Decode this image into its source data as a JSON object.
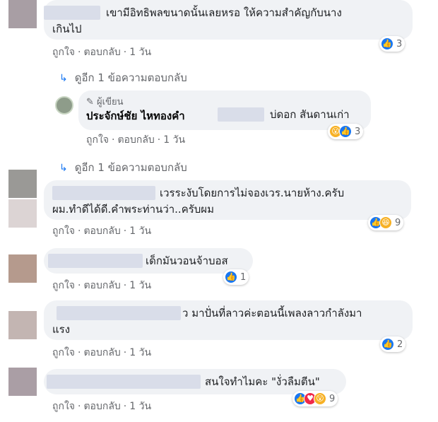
{
  "comments": [
    {
      "text_lines": [
        "เขามีอิทธิพลขนาดนั้นเลยหรอ ให้ความสำคัญกับนาง",
        "เกินไป"
      ],
      "meta": {
        "like": "ถูกใจ",
        "reply": "ตอบกลับ",
        "time": "1 วัน"
      },
      "reactions": {
        "icons": [
          "like-icon"
        ],
        "count": "3"
      },
      "replies_link": "ดูอีก 1 ข้อความตอบกลับ"
    },
    {
      "author_badge": "ผู้เขียน",
      "author_name": "ประจักษ์ชัย ไหทองคำ",
      "text_lines": [
        "บ่ดอก สันดานเก่า"
      ],
      "meta": {
        "like": "ถูกใจ",
        "reply": "ตอบกลับ",
        "time": "1 วัน"
      },
      "reactions": {
        "icons": [
          "wow-icon",
          "like-icon"
        ],
        "count": "3"
      },
      "replies_link": "ดูอีก 1 ข้อความตอบกลับ"
    },
    {
      "text_lines": [
        "เวรระงับโดยการไม่จองเวร.นายห้าง.ครับ",
        "ผม.ทำดีได้ดี.คำพระท่านว่า..ครับผม"
      ],
      "meta": {
        "like": "ถูกใจ",
        "reply": "ตอบกลับ",
        "time": "1 วัน"
      },
      "reactions": {
        "icons": [
          "like-icon",
          "haha-icon"
        ],
        "count": "9"
      }
    },
    {
      "text_lines": [
        "เด็กมันวอนจ้าบอส"
      ],
      "meta": {
        "like": "ถูกใจ",
        "reply": "ตอบกลับ",
        "time": "1 วัน"
      },
      "reactions": {
        "icons": [
          "like-icon"
        ],
        "count": "1"
      }
    },
    {
      "text_lines": [
        "ว มาปั่นที่ลาวค่ะตอนนี้เพลงลาวกำลังมา",
        "แรง"
      ],
      "meta": {
        "like": "ถูกใจ",
        "reply": "ตอบกลับ",
        "time": "1 วัน"
      },
      "reactions": {
        "icons": [
          "like-icon"
        ],
        "count": "2"
      }
    },
    {
      "text_lines": [
        "สนใจทำไมคะ \"งั่วลืมตีน\""
      ],
      "meta": {
        "like": "ถูกใจ",
        "reply": "ตอบกลับ",
        "time": "1 วัน"
      },
      "reactions": {
        "icons": [
          "like-icon",
          "love-icon",
          "wow-icon"
        ],
        "count": "9"
      }
    }
  ],
  "colors": {
    "link_blue": "#1877f2",
    "bubble": "#f0f2f5",
    "meta_gray": "#65676b"
  }
}
